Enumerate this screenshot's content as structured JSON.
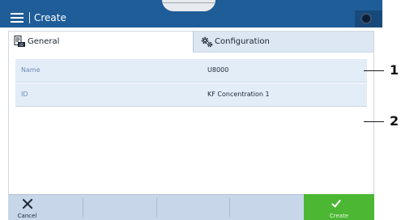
{
  "header": {
    "title": "Create"
  },
  "tabs": [
    {
      "label": "General",
      "icon": "document-id-icon",
      "selected": true
    },
    {
      "label": "Configuration",
      "icon": "gears-icon",
      "selected": false
    }
  ],
  "fields": [
    {
      "label": "Name",
      "value": "U8000"
    },
    {
      "label": "ID",
      "value": "KF Concentration 1"
    }
  ],
  "callouts": [
    "1",
    "2"
  ],
  "footer": {
    "cancel_label": "Cancel",
    "create_label": "Create"
  },
  "colors": {
    "header": "#1e5d98",
    "row": "#e3edf8",
    "footer": "#c7d7e9",
    "create": "#4cb733"
  }
}
